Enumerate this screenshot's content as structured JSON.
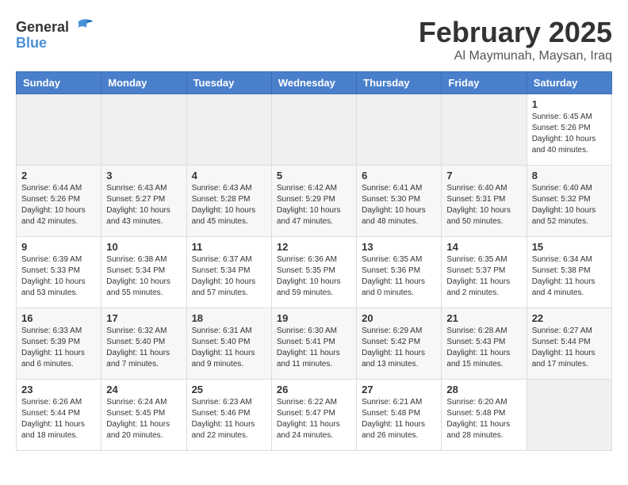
{
  "logo": {
    "general": "General",
    "blue": "Blue"
  },
  "header": {
    "month": "February 2025",
    "location": "Al Maymunah, Maysan, Iraq"
  },
  "weekdays": [
    "Sunday",
    "Monday",
    "Tuesday",
    "Wednesday",
    "Thursday",
    "Friday",
    "Saturday"
  ],
  "weeks": [
    [
      {
        "day": "",
        "info": ""
      },
      {
        "day": "",
        "info": ""
      },
      {
        "day": "",
        "info": ""
      },
      {
        "day": "",
        "info": ""
      },
      {
        "day": "",
        "info": ""
      },
      {
        "day": "",
        "info": ""
      },
      {
        "day": "1",
        "info": "Sunrise: 6:45 AM\nSunset: 5:26 PM\nDaylight: 10 hours and 40 minutes."
      }
    ],
    [
      {
        "day": "2",
        "info": "Sunrise: 6:44 AM\nSunset: 5:26 PM\nDaylight: 10 hours and 42 minutes."
      },
      {
        "day": "3",
        "info": "Sunrise: 6:43 AM\nSunset: 5:27 PM\nDaylight: 10 hours and 43 minutes."
      },
      {
        "day": "4",
        "info": "Sunrise: 6:43 AM\nSunset: 5:28 PM\nDaylight: 10 hours and 45 minutes."
      },
      {
        "day": "5",
        "info": "Sunrise: 6:42 AM\nSunset: 5:29 PM\nDaylight: 10 hours and 47 minutes."
      },
      {
        "day": "6",
        "info": "Sunrise: 6:41 AM\nSunset: 5:30 PM\nDaylight: 10 hours and 48 minutes."
      },
      {
        "day": "7",
        "info": "Sunrise: 6:40 AM\nSunset: 5:31 PM\nDaylight: 10 hours and 50 minutes."
      },
      {
        "day": "8",
        "info": "Sunrise: 6:40 AM\nSunset: 5:32 PM\nDaylight: 10 hours and 52 minutes."
      }
    ],
    [
      {
        "day": "9",
        "info": "Sunrise: 6:39 AM\nSunset: 5:33 PM\nDaylight: 10 hours and 53 minutes."
      },
      {
        "day": "10",
        "info": "Sunrise: 6:38 AM\nSunset: 5:34 PM\nDaylight: 10 hours and 55 minutes."
      },
      {
        "day": "11",
        "info": "Sunrise: 6:37 AM\nSunset: 5:34 PM\nDaylight: 10 hours and 57 minutes."
      },
      {
        "day": "12",
        "info": "Sunrise: 6:36 AM\nSunset: 5:35 PM\nDaylight: 10 hours and 59 minutes."
      },
      {
        "day": "13",
        "info": "Sunrise: 6:35 AM\nSunset: 5:36 PM\nDaylight: 11 hours and 0 minutes."
      },
      {
        "day": "14",
        "info": "Sunrise: 6:35 AM\nSunset: 5:37 PM\nDaylight: 11 hours and 2 minutes."
      },
      {
        "day": "15",
        "info": "Sunrise: 6:34 AM\nSunset: 5:38 PM\nDaylight: 11 hours and 4 minutes."
      }
    ],
    [
      {
        "day": "16",
        "info": "Sunrise: 6:33 AM\nSunset: 5:39 PM\nDaylight: 11 hours and 6 minutes."
      },
      {
        "day": "17",
        "info": "Sunrise: 6:32 AM\nSunset: 5:40 PM\nDaylight: 11 hours and 7 minutes."
      },
      {
        "day": "18",
        "info": "Sunrise: 6:31 AM\nSunset: 5:40 PM\nDaylight: 11 hours and 9 minutes."
      },
      {
        "day": "19",
        "info": "Sunrise: 6:30 AM\nSunset: 5:41 PM\nDaylight: 11 hours and 11 minutes."
      },
      {
        "day": "20",
        "info": "Sunrise: 6:29 AM\nSunset: 5:42 PM\nDaylight: 11 hours and 13 minutes."
      },
      {
        "day": "21",
        "info": "Sunrise: 6:28 AM\nSunset: 5:43 PM\nDaylight: 11 hours and 15 minutes."
      },
      {
        "day": "22",
        "info": "Sunrise: 6:27 AM\nSunset: 5:44 PM\nDaylight: 11 hours and 17 minutes."
      }
    ],
    [
      {
        "day": "23",
        "info": "Sunrise: 6:26 AM\nSunset: 5:44 PM\nDaylight: 11 hours and 18 minutes."
      },
      {
        "day": "24",
        "info": "Sunrise: 6:24 AM\nSunset: 5:45 PM\nDaylight: 11 hours and 20 minutes."
      },
      {
        "day": "25",
        "info": "Sunrise: 6:23 AM\nSunset: 5:46 PM\nDaylight: 11 hours and 22 minutes."
      },
      {
        "day": "26",
        "info": "Sunrise: 6:22 AM\nSunset: 5:47 PM\nDaylight: 11 hours and 24 minutes."
      },
      {
        "day": "27",
        "info": "Sunrise: 6:21 AM\nSunset: 5:48 PM\nDaylight: 11 hours and 26 minutes."
      },
      {
        "day": "28",
        "info": "Sunrise: 6:20 AM\nSunset: 5:48 PM\nDaylight: 11 hours and 28 minutes."
      },
      {
        "day": "",
        "info": ""
      }
    ]
  ]
}
